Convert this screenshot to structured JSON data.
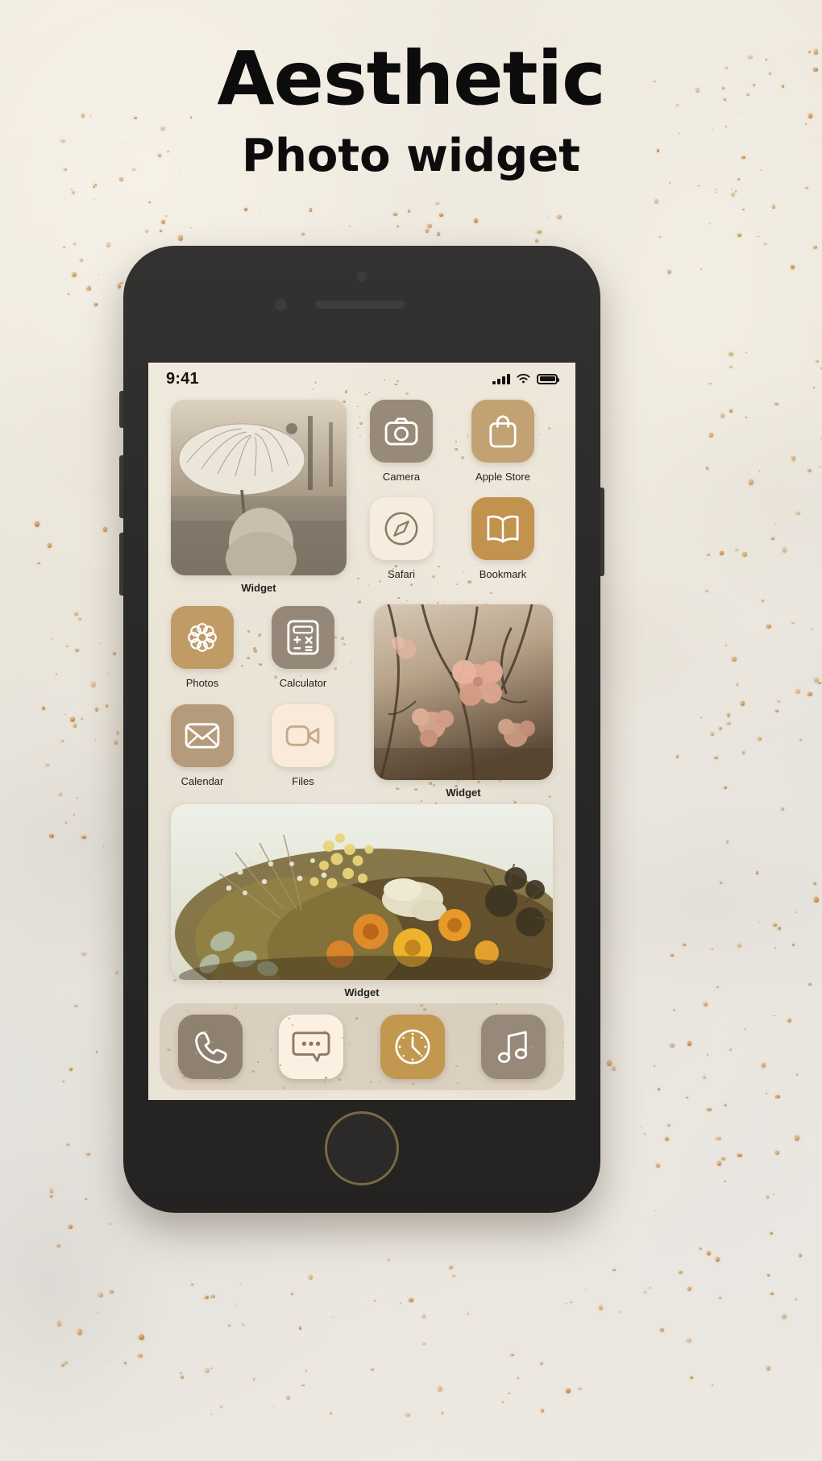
{
  "heading": {
    "title": "Aesthetic",
    "subtitle": "Photo widget"
  },
  "phone": {
    "statusbar": {
      "time": "9:41",
      "signal_icon": "cellular-bars-icon",
      "wifi_icon": "wifi-icon",
      "battery_icon": "battery-icon"
    },
    "widgets": [
      {
        "id": "widget-umbrella",
        "label": "Widget",
        "image": "woman-with-plaid-umbrella-in-autumn-street"
      },
      {
        "id": "widget-blossom",
        "label": "Widget",
        "image": "pink-cherry-blossom-branches"
      },
      {
        "id": "widget-bouquet",
        "label": "Widget",
        "image": "dried-yellow-flower-bouquet"
      }
    ],
    "apps": [
      {
        "id": "camera",
        "label": "Camera",
        "icon": "camera-icon",
        "bg": "#988a79",
        "fg": "#ffffff"
      },
      {
        "id": "apple-store",
        "label": "Apple Store",
        "icon": "shopping-bag-icon",
        "bg": "#c2a173",
        "fg": "#ffffff"
      },
      {
        "id": "safari",
        "label": "Safari",
        "icon": "compass-icon",
        "bg": "#f7ece0",
        "fg": "#8c7a64"
      },
      {
        "id": "bookmark",
        "label": "Bookmark",
        "icon": "open-book-icon",
        "bg": "#c2924f",
        "fg": "#ffffff"
      },
      {
        "id": "photos",
        "label": "Photos",
        "icon": "flower-icon",
        "bg": "#c19b66",
        "fg": "#ffffff"
      },
      {
        "id": "calculator",
        "label": "Calculator",
        "icon": "calculator-icon",
        "bg": "#968879",
        "fg": "#ffffff"
      },
      {
        "id": "calendar",
        "label": "Calendar",
        "icon": "envelope-icon",
        "bg": "#b59b7c",
        "fg": "#ffffff"
      },
      {
        "id": "files",
        "label": "Files",
        "icon": "video-camera-icon",
        "bg": "#faeada",
        "fg": "#c4a98c"
      }
    ],
    "dock": [
      {
        "id": "phone",
        "icon": "phone-handset-icon",
        "bg": "#8e8170",
        "fg": "#ffffff"
      },
      {
        "id": "messages",
        "icon": "chat-bubble-icon",
        "bg": "#fbf0e2",
        "fg": "#8c7a64"
      },
      {
        "id": "clock",
        "icon": "analog-clock-icon",
        "bg": "#c2984f",
        "fg": "#ffffff"
      },
      {
        "id": "music",
        "icon": "music-note-icon",
        "bg": "#978979",
        "fg": "#ffffff"
      }
    ],
    "home_button": "home-button"
  },
  "colors": {
    "page_bg": "#efe9df",
    "phone_body": "#2a2928",
    "gold_fleck": "#c2884a",
    "text_dark": "#0c0c0c"
  }
}
